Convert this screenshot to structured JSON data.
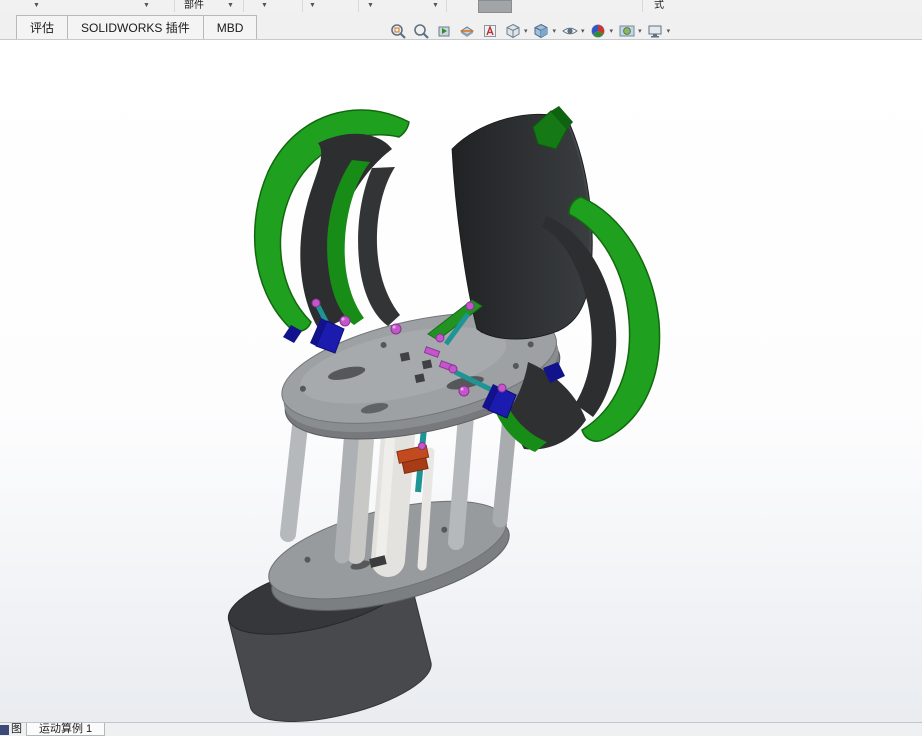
{
  "top_toolbar": {
    "component_label": "部件",
    "style_label": "式"
  },
  "command_tabs": {
    "tabs": [
      {
        "label": "评估"
      },
      {
        "label": "SOLIDWORKS 插件"
      },
      {
        "label": "MBD"
      }
    ]
  },
  "view_toolbar": {
    "icons": [
      "zoom-to-fit",
      "zoom-to-area",
      "previous-view",
      "section-view",
      "dynamic-annotation-views",
      "view-orientation",
      "display-style",
      "hide-show-items",
      "edit-appearance",
      "apply-scene",
      "view-settings"
    ]
  },
  "status_bar": {
    "left_partial_label": "图",
    "motion_study_tab": "运动算例 1"
  },
  "model": {
    "description": "Vertical-axis turbine style CAD assembly with three curved blades, circular plates, support columns and a cylindrical base",
    "colors": {
      "blade_green": "#1fa11f",
      "blade_green_dark": "#178c17",
      "blade_dark": "#2c2e30",
      "plate_gray": "#9ea1a3",
      "column_gray": "#b6b9bb",
      "base_dark": "#47494c",
      "bracket_blue": "#1b1bb0",
      "pin_magenta": "#c455cc",
      "rod_teal": "#1f9494",
      "clamp_orange": "#c14a1e"
    }
  }
}
